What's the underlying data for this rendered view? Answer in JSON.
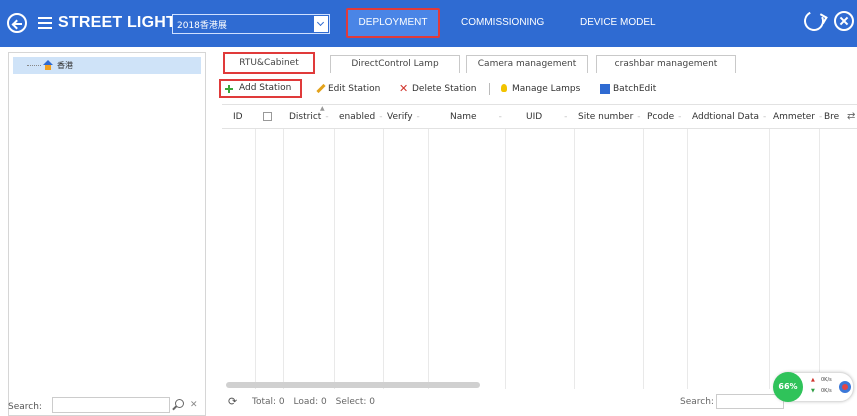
{
  "header": {
    "app_title": "STREET LIGHT",
    "project_selected": "2018香港展",
    "nav_tabs": [
      "DEPLOYMENT",
      "COMMISSIONING",
      "DEVICE MODEL"
    ],
    "active_tab": "DEPLOYMENT",
    "accent_color": "#2f6bd2",
    "highlight_color": "#e03a3a"
  },
  "sidebar": {
    "tree_items": [
      {
        "label": "香港",
        "icon": "home-icon",
        "selected": true
      }
    ],
    "search_label": "Search:",
    "search_value": ""
  },
  "subtabs": [
    "RTU&Cabinet",
    "DirectControl Lamp",
    "Camera management",
    "crashbar management"
  ],
  "active_subtab": "RTU&Cabinet",
  "toolbar": {
    "add_station": "Add Station",
    "edit_station": "Edit Station",
    "delete_station": "Delete Station",
    "manage_lamps": "Manage Lamps",
    "batch_edit": "BatchEdit"
  },
  "grid": {
    "columns": [
      "ID",
      "",
      "District",
      "enabled",
      "Verify",
      "Name",
      "UID",
      "Site number",
      "Pcode",
      "Addtional Data",
      "Ammeter",
      "Bre"
    ],
    "rows": []
  },
  "footer": {
    "total": "Total: 0",
    "load": "Load: 0",
    "select": "Select: 0",
    "search_label": "Search:",
    "search_value": ""
  },
  "net_widget": {
    "percent": "66%",
    "up": "0K/s",
    "down": "0K/s"
  }
}
